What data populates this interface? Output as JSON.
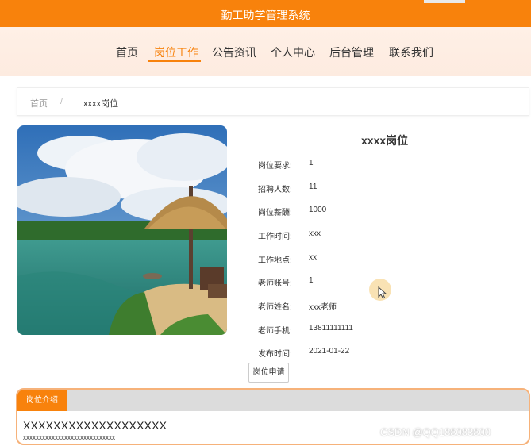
{
  "site": {
    "title": "勤工助学管理系统"
  },
  "nav": {
    "items": [
      {
        "label": "首页"
      },
      {
        "label": "岗位工作"
      },
      {
        "label": "公告资讯"
      },
      {
        "label": "个人中心"
      },
      {
        "label": "后台管理"
      },
      {
        "label": "联系我们"
      }
    ],
    "active_index": 1
  },
  "breadcrumb": {
    "home": "首页",
    "separator": "/",
    "current": "xxxx岗位"
  },
  "job": {
    "title": "xxxx岗位",
    "fields": [
      {
        "label": "岗位要求:",
        "value": "1"
      },
      {
        "label": "招聘人数:",
        "value": "11"
      },
      {
        "label": "岗位薪酬:",
        "value": "1000"
      },
      {
        "label": "工作时间:",
        "value": "xxx"
      },
      {
        "label": "工作地点:",
        "value": "xx"
      },
      {
        "label": "老师账号:",
        "value": "1"
      },
      {
        "label": "老师姓名:",
        "value": "xxx老师"
      },
      {
        "label": "老师手机:",
        "value": "13811111111"
      },
      {
        "label": "发布时间:",
        "value": "2021-01-22"
      }
    ],
    "apply_label": "岗位申请"
  },
  "intro": {
    "tab_label": "岗位介绍",
    "heading": "XXXXXXXXXXXXXXXXXXX",
    "body": "xxxxxxxxxxxxxxxxxxxxxxxxxxxxx"
  },
  "watermark": "CSDN @QQ188083800",
  "colors": {
    "accent": "#f8820c",
    "nav_bg": "#fdeee4",
    "intro_border": "#f6b27a"
  },
  "icons": {
    "cursor": "mouse-pointer-icon"
  }
}
